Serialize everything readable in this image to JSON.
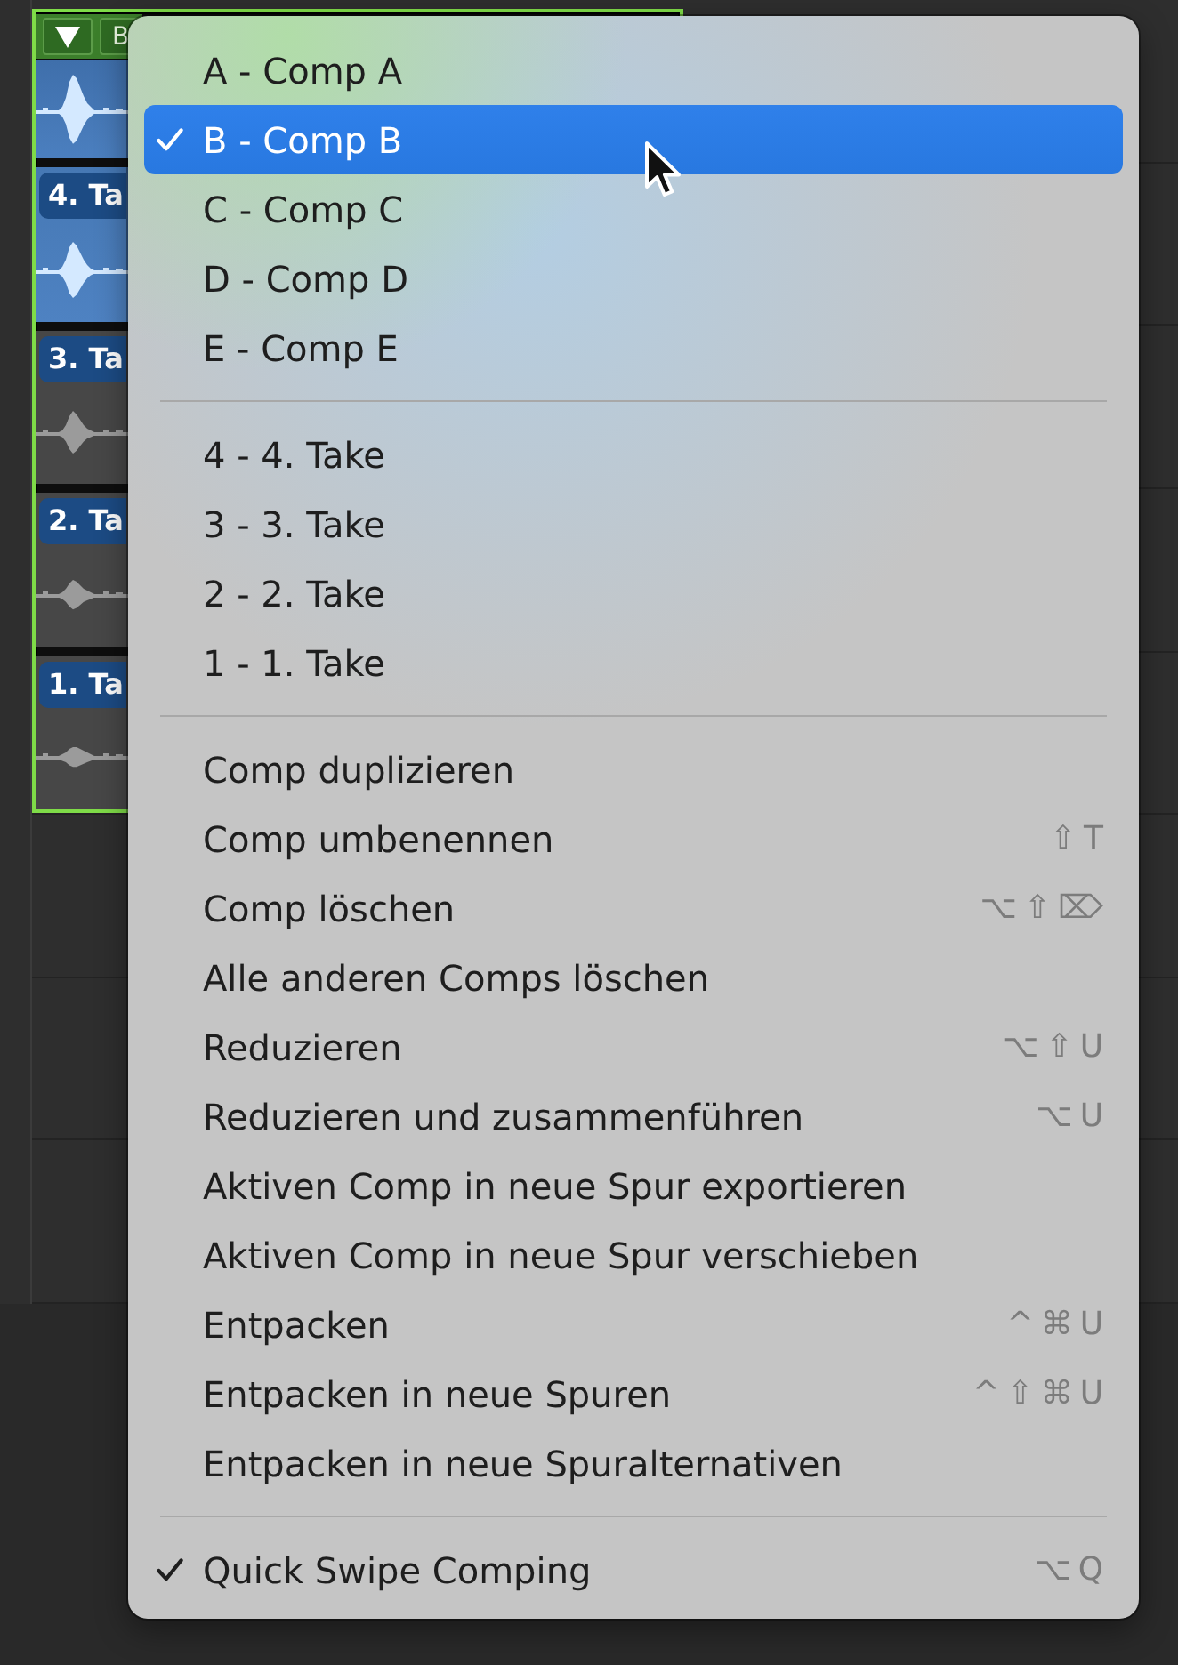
{
  "take_folder": {
    "selected": true,
    "comp_button": {
      "label": "B"
    },
    "takes": [
      {
        "label": "4. Ta",
        "active": true
      },
      {
        "label": "3. Ta",
        "active": false
      },
      {
        "label": "2. Ta",
        "active": false
      },
      {
        "label": "1. Ta",
        "active": false
      }
    ]
  },
  "context_menu": {
    "groups": [
      {
        "items": [
          {
            "label": "A - Comp A",
            "checked": false,
            "selected": false
          },
          {
            "label": "B - Comp B",
            "checked": true,
            "selected": true
          },
          {
            "label": "C - Comp C",
            "checked": false,
            "selected": false
          },
          {
            "label": "D - Comp D",
            "checked": false,
            "selected": false
          },
          {
            "label": "E - Comp E",
            "checked": false,
            "selected": false
          }
        ]
      },
      {
        "items": [
          {
            "label": "4 - 4. Take",
            "checked": false,
            "selected": false
          },
          {
            "label": "3 - 3. Take",
            "checked": false,
            "selected": false
          },
          {
            "label": "2 - 2. Take",
            "checked": false,
            "selected": false
          },
          {
            "label": "1 - 1. Take",
            "checked": false,
            "selected": false
          }
        ]
      },
      {
        "items": [
          {
            "label": "Comp duplizieren",
            "checked": false,
            "selected": false
          },
          {
            "label": "Comp umbenennen",
            "shortcut": "⇧T",
            "checked": false,
            "selected": false
          },
          {
            "label": "Comp löschen",
            "shortcut": "⌥⇧⌦",
            "checked": false,
            "selected": false
          },
          {
            "label": "Alle anderen Comps löschen",
            "checked": false,
            "selected": false
          },
          {
            "label": "Reduzieren",
            "shortcut": "⌥⇧U",
            "checked": false,
            "selected": false
          },
          {
            "label": "Reduzieren und zusammenführen",
            "shortcut": "⌥U",
            "checked": false,
            "selected": false
          },
          {
            "label": "Aktiven Comp in neue Spur exportieren",
            "checked": false,
            "selected": false
          },
          {
            "label": "Aktiven Comp in neue Spur verschieben",
            "checked": false,
            "selected": false
          },
          {
            "label": "Entpacken",
            "shortcut": "^⌘U",
            "checked": false,
            "selected": false
          },
          {
            "label": "Entpacken in neue Spuren",
            "shortcut": "^⇧⌘U",
            "checked": false,
            "selected": false
          },
          {
            "label": "Entpacken in neue Spuralternativen",
            "checked": false,
            "selected": false
          }
        ]
      },
      {
        "items": [
          {
            "label": "Quick Swipe Comping",
            "shortcut": "⌥Q",
            "checked": true,
            "selected": false
          }
        ]
      }
    ]
  }
}
